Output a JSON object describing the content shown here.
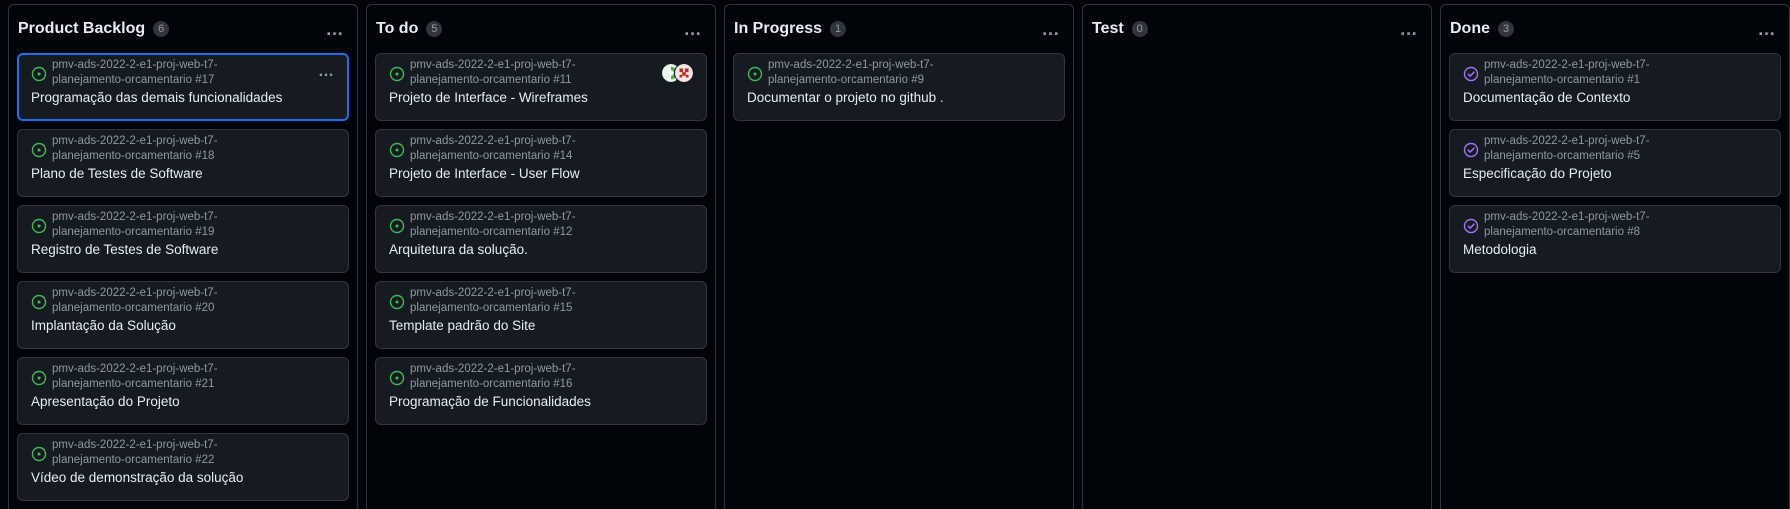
{
  "columns": [
    {
      "title": "Product Backlog",
      "count": "6",
      "cards": [
        {
          "ref_line1": "pmv-ads-2022-2-e1-proj-web-t7-",
          "ref_line2": "planejamento-orcamentario #17",
          "title": "Programação das demais funcionalidades",
          "status": "open",
          "selected": true
        },
        {
          "ref_line1": "pmv-ads-2022-2-e1-proj-web-t7-",
          "ref_line2": "planejamento-orcamentario #18",
          "title": "Plano de Testes de Software",
          "status": "open"
        },
        {
          "ref_line1": "pmv-ads-2022-2-e1-proj-web-t7-",
          "ref_line2": "planejamento-orcamentario #19",
          "title": "Registro de Testes de Software",
          "status": "open"
        },
        {
          "ref_line1": "pmv-ads-2022-2-e1-proj-web-t7-",
          "ref_line2": "planejamento-orcamentario #20",
          "title": "Implantação da Solução",
          "status": "open"
        },
        {
          "ref_line1": "pmv-ads-2022-2-e1-proj-web-t7-",
          "ref_line2": "planejamento-orcamentario #21",
          "title": "Apresentação do Projeto",
          "status": "open"
        },
        {
          "ref_line1": "pmv-ads-2022-2-e1-proj-web-t7-",
          "ref_line2": "planejamento-orcamentario #22",
          "title": "Vídeo de demonstração da solução",
          "status": "open"
        }
      ]
    },
    {
      "title": "To do",
      "count": "5",
      "cards": [
        {
          "ref_line1": "pmv-ads-2022-2-e1-proj-web-t7-",
          "ref_line2": "planejamento-orcamentario #11",
          "title": "Projeto de Interface - Wireframes",
          "status": "open",
          "avatars": true
        },
        {
          "ref_line1": "pmv-ads-2022-2-e1-proj-web-t7-",
          "ref_line2": "planejamento-orcamentario #14",
          "title": "Projeto de Interface - User Flow",
          "status": "open"
        },
        {
          "ref_line1": "pmv-ads-2022-2-e1-proj-web-t7-",
          "ref_line2": "planejamento-orcamentario #12",
          "title": "Arquitetura da solução.",
          "status": "open"
        },
        {
          "ref_line1": "pmv-ads-2022-2-e1-proj-web-t7-",
          "ref_line2": "planejamento-orcamentario #15",
          "title": "Template padrão do Site",
          "status": "open"
        },
        {
          "ref_line1": "pmv-ads-2022-2-e1-proj-web-t7-",
          "ref_line2": "planejamento-orcamentario #16",
          "title": "Programação de Funcionalidades",
          "status": "open"
        }
      ]
    },
    {
      "title": "In Progress",
      "count": "1",
      "cards": [
        {
          "ref_line1": "pmv-ads-2022-2-e1-proj-web-t7-",
          "ref_line2": "planejamento-orcamentario #9",
          "title": "Documentar o projeto no github .",
          "status": "open"
        }
      ]
    },
    {
      "title": "Test",
      "count": "0",
      "cards": []
    },
    {
      "title": "Done",
      "count": "3",
      "cards": [
        {
          "ref_line1": "pmv-ads-2022-2-e1-proj-web-t7-",
          "ref_line2": "planejamento-orcamentario #1",
          "title": "Documentação de Contexto",
          "status": "closed"
        },
        {
          "ref_line1": "pmv-ads-2022-2-e1-proj-web-t7-",
          "ref_line2": "planejamento-orcamentario #5",
          "title": "Especificação do Projeto",
          "status": "closed"
        },
        {
          "ref_line1": "pmv-ads-2022-2-e1-proj-web-t7-",
          "ref_line2": "planejamento-orcamentario #8",
          "title": "Metodologia",
          "status": "closed"
        }
      ]
    }
  ],
  "colors": {
    "open": "#3fb950",
    "closed": "#a371f7",
    "selected_border": "#1f6feb"
  },
  "menu_glyph": "…"
}
